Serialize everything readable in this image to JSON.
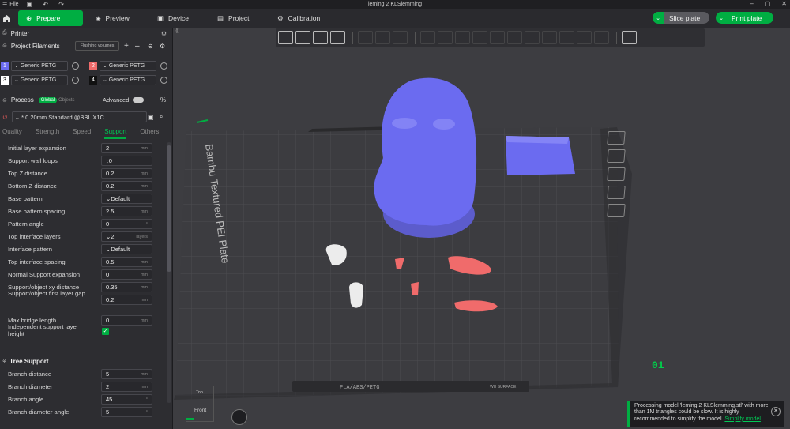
{
  "window": {
    "title": "leming 2 KLSlemming",
    "menu_file": "File"
  },
  "tabs": [
    {
      "label": "Prepare",
      "icon": "prepare-icon",
      "active": true
    },
    {
      "label": "Preview",
      "icon": "preview-icon"
    },
    {
      "label": "Device",
      "icon": "device-icon"
    },
    {
      "label": "Project",
      "icon": "project-icon"
    },
    {
      "label": "Calibration",
      "icon": "calibration-icon"
    }
  ],
  "actions": {
    "slice": "Slice plate",
    "print": "Print plate"
  },
  "printer": {
    "label": "Printer"
  },
  "filaments": {
    "label": "Project Filaments",
    "flushing": "Flushing volumes",
    "items": [
      {
        "num": "1",
        "name": "Generic PETG",
        "color": "#6b6bf0"
      },
      {
        "num": "2",
        "name": "Generic PETG",
        "color": "#f06b6b"
      },
      {
        "num": "3",
        "name": "Generic PETG",
        "color": "#ffffff"
      },
      {
        "num": "4",
        "name": "Generic PETG",
        "color": "#111111"
      }
    ]
  },
  "process": {
    "label": "Process",
    "global": "Global",
    "objects": "Objects",
    "advanced": "Advanced",
    "preset": "* 0.20mm Standard @BBL X1C",
    "tabs": [
      "Quality",
      "Strength",
      "Speed",
      "Support",
      "Others"
    ],
    "active_tab": "Support"
  },
  "settings": [
    {
      "label": "Initial layer expansion",
      "value": "2",
      "unit": "mm"
    },
    {
      "label": "Support wall loops",
      "value": "0",
      "unit": ""
    },
    {
      "label": "Top Z distance",
      "value": "0.2",
      "unit": "mm"
    },
    {
      "label": "Bottom Z distance",
      "value": "0.2",
      "unit": "mm"
    },
    {
      "label": "Base pattern",
      "value": "Default",
      "unit": ""
    },
    {
      "label": "Base pattern spacing",
      "value": "2.5",
      "unit": "mm"
    },
    {
      "label": "Pattern angle",
      "value": "0",
      "unit": "°"
    },
    {
      "label": "Top interface layers",
      "value": "2",
      "unit": "layers"
    },
    {
      "label": "Interface pattern",
      "value": "Default",
      "unit": ""
    },
    {
      "label": "Top interface spacing",
      "value": "0.5",
      "unit": "mm"
    },
    {
      "label": "Normal Support expansion",
      "value": "0",
      "unit": "mm"
    },
    {
      "label": "Support/object xy distance",
      "value": "0.35",
      "unit": "mm"
    },
    {
      "label": "Support/object first layer gap",
      "value": "0.2",
      "unit": "mm"
    },
    {
      "label": "Max bridge length",
      "value": "0",
      "unit": "mm"
    },
    {
      "label": "Independent support layer height",
      "value": "",
      "unit": ""
    }
  ],
  "tree_support": {
    "label": "Tree Support",
    "settings": [
      {
        "label": "Branch distance",
        "value": "5",
        "unit": "mm"
      },
      {
        "label": "Branch diameter",
        "value": "2",
        "unit": "mm"
      },
      {
        "label": "Branch angle",
        "value": "45",
        "unit": "°"
      },
      {
        "label": "Branch diameter angle",
        "value": "5",
        "unit": "°"
      }
    ]
  },
  "plate": {
    "brand_text": "Bambu Textured PEI Plate",
    "plate_number": "01",
    "tag_text": "PLA/ABS/PETG",
    "tag_text2": "WH SURFACE"
  },
  "viewcube": {
    "top": "Top",
    "front": "Front"
  },
  "notice": {
    "text": "Processing model 'leming 2 KLSlemming.stl' with more than 1M triangles could be slow. It is highly recommended to simplify the model.",
    "link": "Simplify model"
  },
  "colors": {
    "accent": "#00ae42",
    "model_blue": "#6b6bf0",
    "model_red": "#f06b6b"
  }
}
